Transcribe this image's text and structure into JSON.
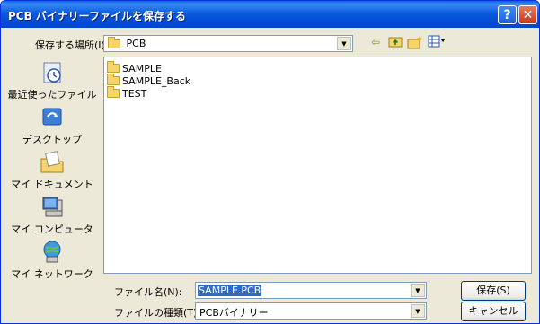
{
  "window": {
    "title": "PCB バイナリーファイルを保存する"
  },
  "titlebar_buttons": {
    "help": "?",
    "close": "✕"
  },
  "location": {
    "label": "保存する場所(I):",
    "value": "PCB"
  },
  "places": [
    {
      "label": "最近使ったファイル",
      "icon": "recent-files-icon"
    },
    {
      "label": "デスクトップ",
      "icon": "desktop-icon"
    },
    {
      "label": "マイ ドキュメント",
      "icon": "my-documents-icon"
    },
    {
      "label": "マイ コンピュータ",
      "icon": "my-computer-icon"
    },
    {
      "label": "マイ ネットワーク",
      "icon": "my-network-icon"
    }
  ],
  "files": [
    "SAMPLE",
    "SAMPLE_Back",
    "TEST"
  ],
  "filename": {
    "label": "ファイル名(N):",
    "value": "SAMPLE.PCB"
  },
  "filetype": {
    "label": "ファイルの種類(T):",
    "value": "PCBバイナリー"
  },
  "buttons": {
    "save": "保存(S)",
    "cancel": "キャンセル"
  }
}
